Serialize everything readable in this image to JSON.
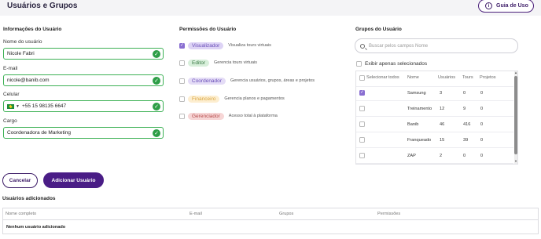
{
  "header": {
    "title": "Usuários e Grupos",
    "guide_label": "Guia de Uso",
    "guide_icon": "info-icon"
  },
  "user_info": {
    "title": "Informações do Usuário",
    "name_label": "Nome do usuário",
    "name_value": "Nicole Fabri",
    "email_label": "E-mail",
    "email_value": "nicole@banib.com",
    "phone_label": "Celular",
    "phone_value": "+55 15 98135 6647",
    "phone_flag": "brazil-flag-icon",
    "role_label": "Cargo",
    "role_value": "Coordenadora de Marketing"
  },
  "permissions": {
    "title": "Permissões do Usuário",
    "items": [
      {
        "label": "Visualizador",
        "desc": "Visualiza tours virtuais",
        "checked": true,
        "bg": "#ddd3f5",
        "color": "#6a4fb8"
      },
      {
        "label": "Editor",
        "desc": "Gerencia tours virtuais",
        "checked": false,
        "bg": "#d8efdb",
        "color": "#3b7a47"
      },
      {
        "label": "Coordenador",
        "desc": "Gerencia usuários, grupos, áreas e projetos",
        "checked": false,
        "bg": "#e4dcf6",
        "color": "#6a4fb8"
      },
      {
        "label": "Financeiro",
        "desc": "Gerencia planos e pagamentos",
        "checked": false,
        "bg": "#fdeed0",
        "color": "#d9a640"
      },
      {
        "label": "Gerenciador",
        "desc": "Acesso total à plataforma",
        "checked": false,
        "bg": "#f7d6d6",
        "color": "#b54a4a"
      }
    ]
  },
  "groups": {
    "title": "Grupos do Usuário",
    "search_placeholder": "Buscar pelos campos Nome",
    "only_selected_label": "Exibir apenas selecionados",
    "columns": [
      "Selecionar todos",
      "Nome",
      "Usuários",
      "Tours",
      "Projetos"
    ],
    "rows": [
      {
        "name": "Samsung",
        "users": "3",
        "tours": "0",
        "projects": "0",
        "checked": true
      },
      {
        "name": "Treinamento",
        "users": "12",
        "tours": "9",
        "projects": "0",
        "checked": false
      },
      {
        "name": "Banib",
        "users": "46",
        "tours": "416",
        "projects": "0",
        "checked": false
      },
      {
        "name": "Franqueado",
        "users": "15",
        "tours": "39",
        "projects": "0",
        "checked": false
      },
      {
        "name": "ZAP",
        "users": "2",
        "tours": "0",
        "projects": "0",
        "checked": false
      }
    ]
  },
  "actions": {
    "cancel_label": "Cancelar",
    "add_label": "Adicionar Usuário"
  },
  "added_users": {
    "title": "Usuários adicionados",
    "columns": [
      "Nome completo",
      "E-mail",
      "Grupos",
      "Permissões"
    ],
    "empty_text": "Nenhum usuário adicionado"
  }
}
